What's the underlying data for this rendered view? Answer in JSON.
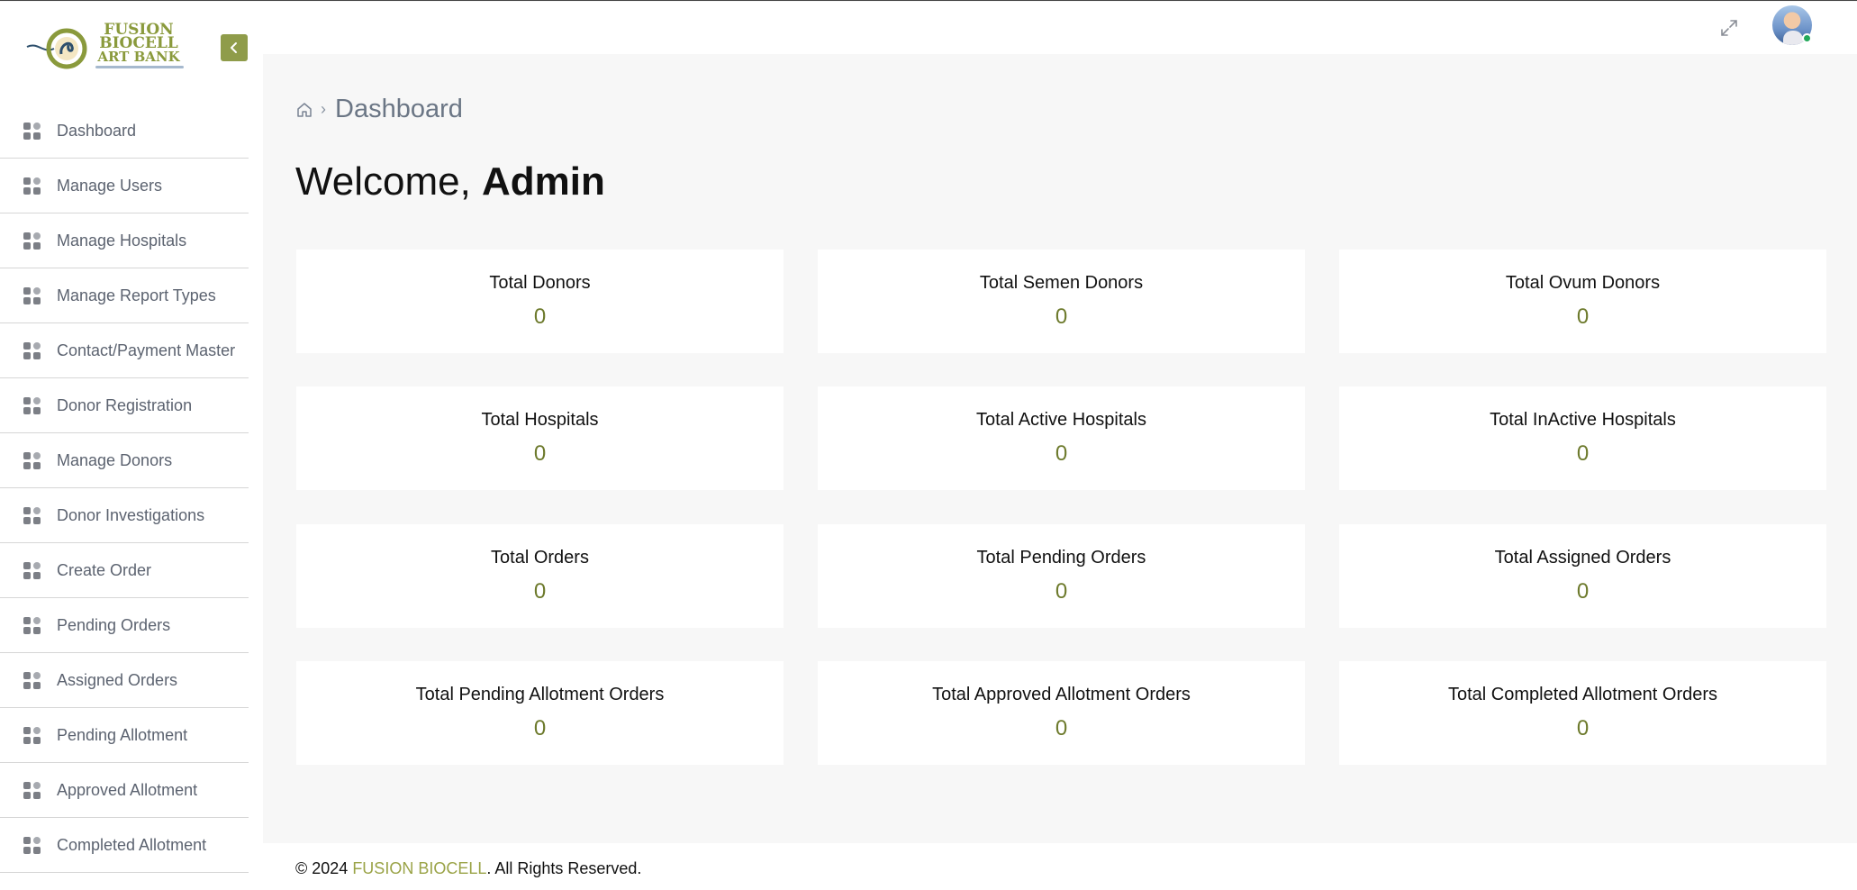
{
  "brand": {
    "line1": "FUSION",
    "line2": "BIOCELL",
    "line3": "ART BANK"
  },
  "sidebar": {
    "items": [
      {
        "label": "Dashboard"
      },
      {
        "label": "Manage Users"
      },
      {
        "label": "Manage Hospitals"
      },
      {
        "label": "Manage Report Types"
      },
      {
        "label": "Contact/Payment Master"
      },
      {
        "label": "Donor Registration"
      },
      {
        "label": "Manage Donors"
      },
      {
        "label": "Donor Investigations"
      },
      {
        "label": "Create Order"
      },
      {
        "label": "Pending Orders"
      },
      {
        "label": "Assigned Orders"
      },
      {
        "label": "Pending Allotment"
      },
      {
        "label": "Approved Allotment"
      },
      {
        "label": "Completed Allotment"
      }
    ]
  },
  "breadcrumb": {
    "current": "Dashboard"
  },
  "welcome": {
    "greeting": "Welcome, ",
    "name": "Admin"
  },
  "stats": [
    {
      "title": "Total Donors",
      "value": "0"
    },
    {
      "title": "Total Semen Donors",
      "value": "0"
    },
    {
      "title": "Total Ovum Donors",
      "value": "0"
    },
    {
      "title": "Total Hospitals",
      "value": "0"
    },
    {
      "title": "Total Active Hospitals",
      "value": "0"
    },
    {
      "title": "Total InActive Hospitals",
      "value": "0"
    },
    {
      "title": "Total Orders",
      "value": "0"
    },
    {
      "title": "Total Pending Orders",
      "value": "0"
    },
    {
      "title": "Total Assigned Orders",
      "value": "0"
    },
    {
      "title": "Total Pending Allotment Orders",
      "value": "0"
    },
    {
      "title": "Total Approved Allotment Orders",
      "value": "0"
    },
    {
      "title": "Total Completed Allotment Orders",
      "value": "0"
    }
  ],
  "footer": {
    "prefix": "© 2024 ",
    "brand": "FUSION BIOCELL",
    "suffix": ". All Rights Reserved."
  },
  "colors": {
    "accent": "#8f9c4a",
    "value": "#6d7a2c",
    "footer_brand": "#9aa347"
  },
  "icons": {
    "collapse": "chevron-left-icon",
    "nav": "grid-icon",
    "home": "home-icon",
    "fullscreen": "expand-icon"
  }
}
